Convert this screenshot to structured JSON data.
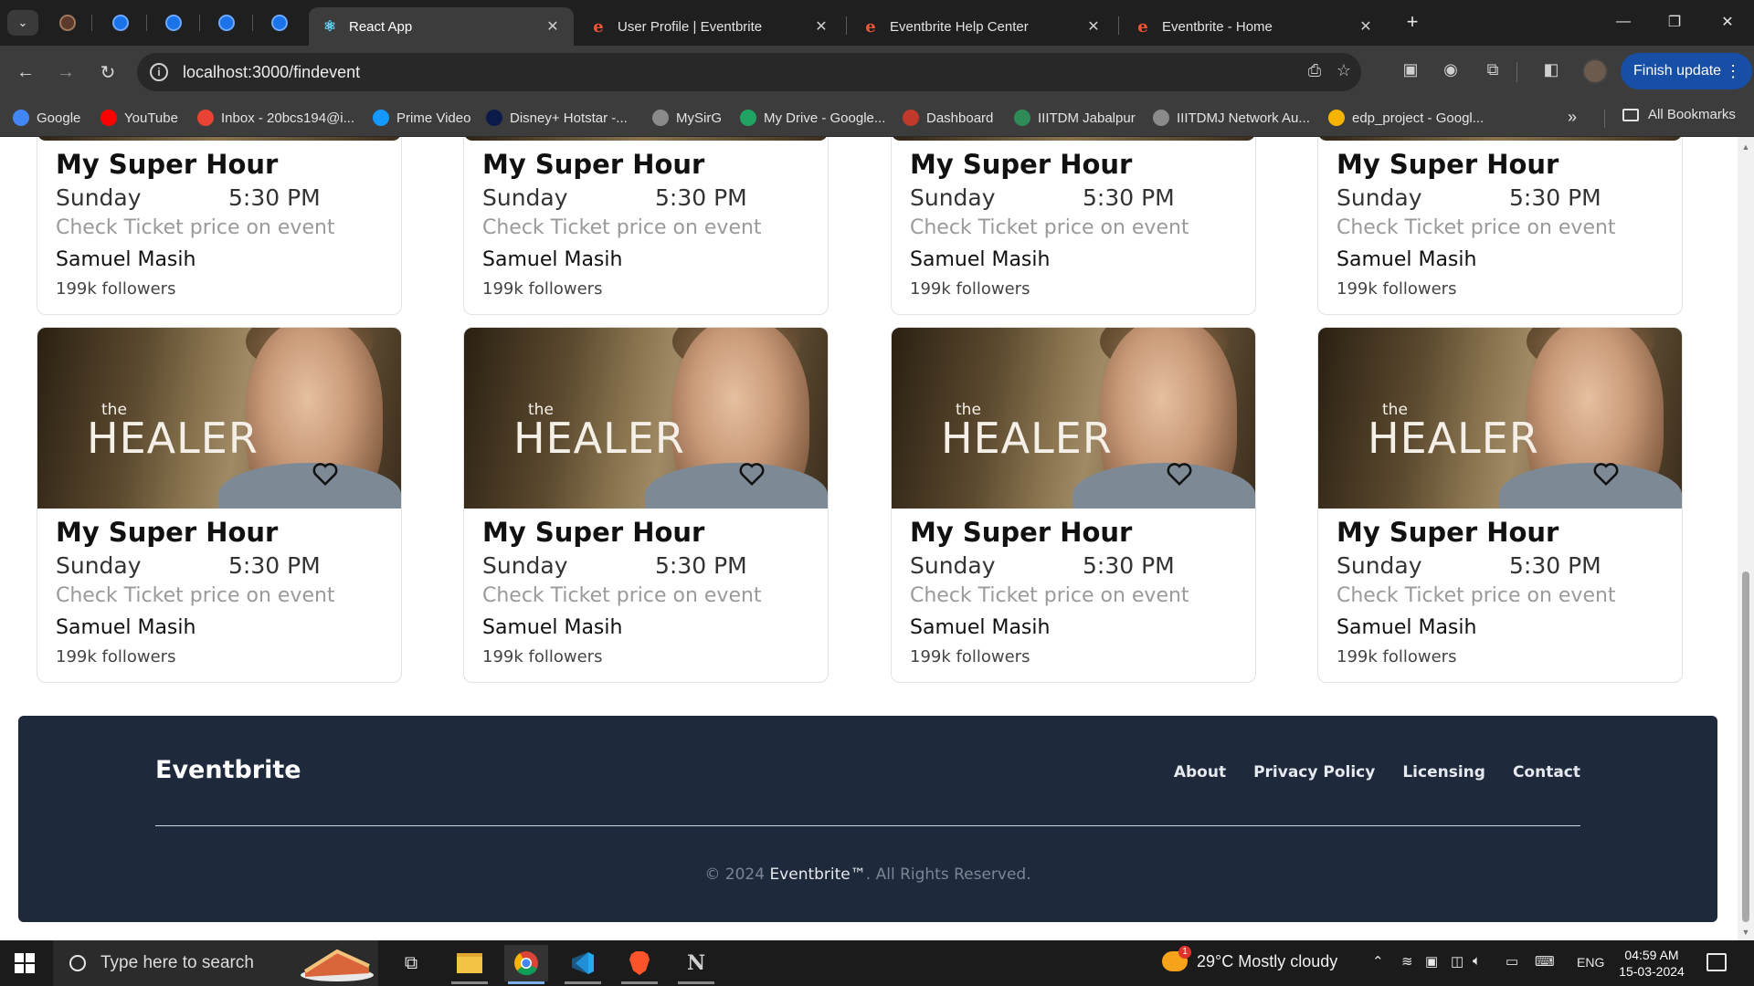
{
  "browser": {
    "tabs": [
      {
        "title": "React App",
        "active": true,
        "icon": "react-icon"
      },
      {
        "title": "User Profile | Eventbrite",
        "active": false,
        "icon": "eventbrite-icon"
      },
      {
        "title": "Eventbrite Help Center",
        "active": false,
        "icon": "eventbrite-icon"
      },
      {
        "title": "Eventbrite - Home",
        "active": false,
        "icon": "eventbrite-icon"
      }
    ],
    "url": "localhost:3000/findevent",
    "update_button": "Finish update",
    "bookmarks": [
      {
        "label": "Google",
        "icon": "google-icon",
        "color": "#4285f4"
      },
      {
        "label": "YouTube",
        "icon": "youtube-icon",
        "color": "#ff0000"
      },
      {
        "label": "Inbox - 20bcs194@i...",
        "icon": "gmail-icon",
        "color": "#ea4335"
      },
      {
        "label": "Prime Video",
        "icon": "prime-video-icon",
        "color": "#1399ff"
      },
      {
        "label": "Disney+ Hotstar -...",
        "icon": "hotstar-icon",
        "color": "#0c1a4a"
      },
      {
        "label": "MySirG",
        "icon": "globe-icon",
        "color": "#8a8a8a"
      },
      {
        "label": "My Drive - Google...",
        "icon": "google-drive-icon",
        "color": "#1fa463"
      },
      {
        "label": "Dashboard",
        "icon": "dashboard-icon",
        "color": "#c0392b"
      },
      {
        "label": "IIITDM Jabalpur",
        "icon": "iiitdm-icon",
        "color": "#2e8b57"
      },
      {
        "label": "IIITDMJ Network Au...",
        "icon": "globe-icon",
        "color": "#8a8a8a"
      },
      {
        "label": "edp_project - Googl...",
        "icon": "google-drive-icon",
        "color": "#f4b400"
      }
    ],
    "all_bookmarks": "All Bookmarks"
  },
  "events": [
    {
      "title": "My Super Hour",
      "day": "Sunday",
      "time": "5:30 PM",
      "price": "Check Ticket price on event",
      "organizer": "Samuel Masih",
      "followers": "199k followers"
    },
    {
      "title": "My Super Hour",
      "day": "Sunday",
      "time": "5:30 PM",
      "price": "Check Ticket price on event",
      "organizer": "Samuel Masih",
      "followers": "199k followers"
    },
    {
      "title": "My Super Hour",
      "day": "Sunday",
      "time": "5:30 PM",
      "price": "Check Ticket price on event",
      "organizer": "Samuel Masih",
      "followers": "199k followers"
    },
    {
      "title": "My Super Hour",
      "day": "Sunday",
      "time": "5:30 PM",
      "price": "Check Ticket price on event",
      "organizer": "Samuel Masih",
      "followers": "199k followers"
    },
    {
      "title": "My Super Hour",
      "day": "Sunday",
      "time": "5:30 PM",
      "price": "Check Ticket price on event",
      "organizer": "Samuel Masih",
      "followers": "199k followers",
      "poster_small": "the",
      "poster_big": "HEALER"
    },
    {
      "title": "My Super Hour",
      "day": "Sunday",
      "time": "5:30 PM",
      "price": "Check Ticket price on event",
      "organizer": "Samuel Masih",
      "followers": "199k followers",
      "poster_small": "the",
      "poster_big": "HEALER"
    },
    {
      "title": "My Super Hour",
      "day": "Sunday",
      "time": "5:30 PM",
      "price": "Check Ticket price on event",
      "organizer": "Samuel Masih",
      "followers": "199k followers",
      "poster_small": "the",
      "poster_big": "HEALER"
    },
    {
      "title": "My Super Hour",
      "day": "Sunday",
      "time": "5:30 PM",
      "price": "Check Ticket price on event",
      "organizer": "Samuel Masih",
      "followers": "199k followers",
      "poster_small": "the",
      "poster_big": "HEALER"
    }
  ],
  "footer": {
    "brand": "Eventbrite",
    "links": [
      "About",
      "Privacy Policy",
      "Licensing",
      "Contact"
    ],
    "copyright_prefix": "© 2024",
    "copyright_brand": "Eventbrite™",
    "copyright_suffix": ". All Rights Reserved."
  },
  "taskbar": {
    "search_placeholder": "Type here to search",
    "weather": "29°C  Mostly cloudy",
    "weather_badge": "1",
    "language": "ENG",
    "time": "04:59 AM",
    "date": "15-03-2024"
  },
  "colors": {
    "footer_bg": "#1e293b",
    "chrome_bg": "#3c3c3c",
    "update_button": "#174ea6",
    "eventbrite_orange": "#f05537"
  }
}
